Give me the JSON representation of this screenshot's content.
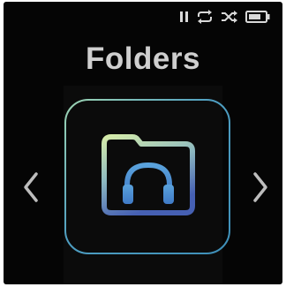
{
  "screen": {
    "title": "Folders"
  },
  "status": {
    "play_state_icon": "pause-icon",
    "repeat_icon": "repeat-icon",
    "shuffle_icon": "shuffle-icon",
    "battery_icon": "battery-icon"
  },
  "navigation": {
    "prev_icon": "chevron-left-icon",
    "next_icon": "chevron-right-icon"
  },
  "selected_item": {
    "icon": "music-folder-icon"
  },
  "colors": {
    "background": "#050505",
    "title": "#cfcfcf",
    "accent_gradient_top": "#cfe7a8",
    "accent_gradient_bottom": "#4c6ab8",
    "headphones": "#4f8fd3"
  }
}
